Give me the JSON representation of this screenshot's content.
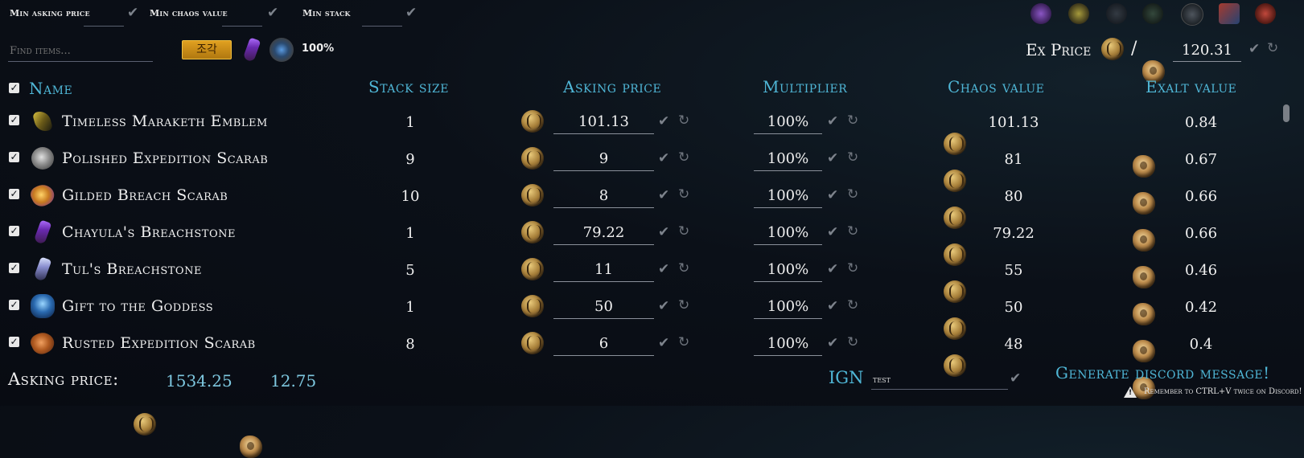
{
  "filters": {
    "min_asking_price_label": "Min asking price",
    "min_chaos_value_label": "Min chaos value",
    "min_stack_label": "Min stack"
  },
  "search": {
    "placeholder": "Find items..."
  },
  "language_tag": "조각",
  "league_percent": "100%",
  "ex_price": {
    "label": "Ex Price",
    "separator": "/",
    "value": "120.31"
  },
  "columns": {
    "name": "Name",
    "stack_size": "Stack size",
    "asking_price": "Asking price",
    "multiplier": "Multiplier",
    "chaos_value": "Chaos value",
    "exalt_value": "Exalt value"
  },
  "items": [
    {
      "name": "Timeless Maraketh Emblem",
      "icon": "maraketh-emblem-icon",
      "stack": "1",
      "asking": "101.13",
      "multiplier": "100%",
      "chaos": "101.13",
      "exalt": "0.84"
    },
    {
      "name": "Polished Expedition Scarab",
      "icon": "expedition-scarab-icon",
      "stack": "9",
      "asking": "9",
      "multiplier": "100%",
      "chaos": "81",
      "exalt": "0.67"
    },
    {
      "name": "Gilded Breach Scarab",
      "icon": "breach-scarab-icon",
      "stack": "10",
      "asking": "8",
      "multiplier": "100%",
      "chaos": "80",
      "exalt": "0.66"
    },
    {
      "name": "Chayula's Breachstone",
      "icon": "chayula-breachstone-icon",
      "stack": "1",
      "asking": "79.22",
      "multiplier": "100%",
      "chaos": "79.22",
      "exalt": "0.66"
    },
    {
      "name": "Tul's Breachstone",
      "icon": "tul-breachstone-icon",
      "stack": "5",
      "asking": "11",
      "multiplier": "100%",
      "chaos": "55",
      "exalt": "0.46"
    },
    {
      "name": "Gift to the Goddess",
      "icon": "gift-goddess-icon",
      "stack": "1",
      "asking": "50",
      "multiplier": "100%",
      "chaos": "50",
      "exalt": "0.42"
    },
    {
      "name": "Rusted Expedition Scarab",
      "icon": "rusted-scarab-icon",
      "stack": "8",
      "asking": "6",
      "multiplier": "100%",
      "chaos": "48",
      "exalt": "0.4"
    }
  ],
  "footer": {
    "asking_price_label": "Asking price:",
    "total_chaos": "1534.25",
    "total_exalt": "12.75",
    "ign_label": "IGN",
    "ign_value": "test",
    "generate_label": "Generate discord message!",
    "reminder": "Remember to CTRL+V twice on Discord!"
  },
  "colors": {
    "accent": "#4fb6d6",
    "value_blue": "#7ec8e0",
    "background": "#080b12"
  }
}
